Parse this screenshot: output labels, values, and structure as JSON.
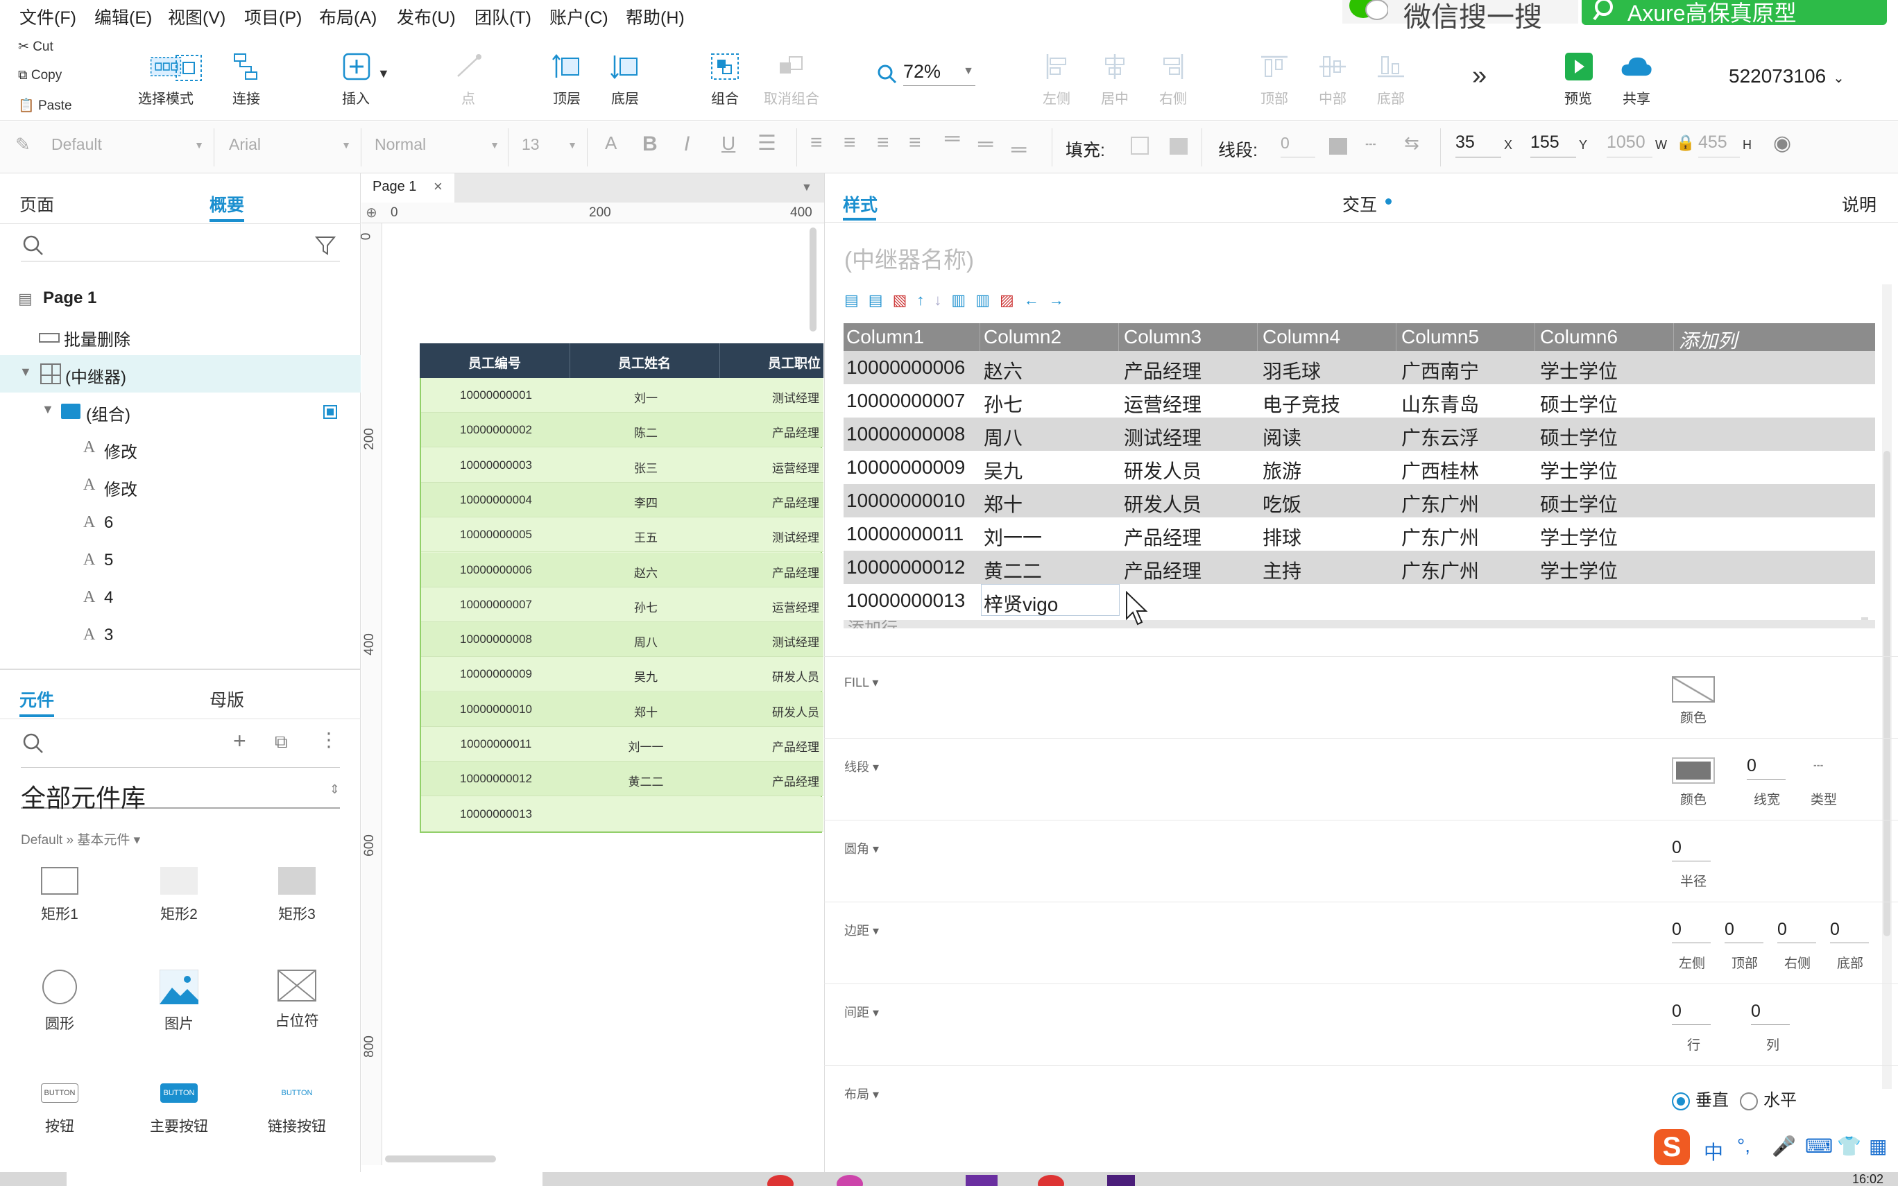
{
  "menu": [
    "文件(F)",
    "编辑(E)",
    "视图(V)",
    "项目(P)",
    "布局(A)",
    "发布(U)",
    "团队(T)",
    "账户(C)",
    "帮助(H)"
  ],
  "clipboard": {
    "cut": "Cut",
    "copy": "Copy",
    "paste": "Paste"
  },
  "tools": {
    "select": "选择模式",
    "connect": "连接",
    "insert": "插入",
    "point": "点",
    "top": "顶层",
    "bottom": "底层",
    "group": "组合",
    "ungroup": "取消组合",
    "zoom": "72%",
    "left": "左侧",
    "center": "居中",
    "right": "右侧",
    "atop": "顶部",
    "amid": "中部",
    "abottom": "底部",
    "preview": "预览",
    "share": "共享",
    "account": "522073106"
  },
  "overlay": {
    "wechat": "微信搜一搜",
    "search": "Axure高保真原型"
  },
  "format": {
    "style": "Default",
    "font": "Arial",
    "weight": "Normal",
    "size": "13",
    "fill": "填充:",
    "stroke": "线段:",
    "stroke_val": "0",
    "x": "35",
    "x_lbl": "X",
    "y": "155",
    "y_lbl": "Y",
    "w": "1050",
    "w_lbl": "W",
    "h": "455",
    "h_lbl": "H"
  },
  "left": {
    "tab_pages": "页面",
    "tab_outline": "概要",
    "outline": [
      "Page 1",
      "批量删除",
      "(中继器)",
      "(组合)",
      "修改",
      "修改",
      "6",
      "5",
      "4",
      "3"
    ],
    "tab_widgets": "元件",
    "tab_masters": "母版",
    "library": "全部元件库",
    "library_sub": "Default » 基本元件 ▾",
    "widgets": [
      "矩形1",
      "矩形2",
      "矩形3",
      "圆形",
      "图片",
      "占位符",
      "按钮",
      "主要按钮",
      "链接按钮"
    ],
    "btn_text": "BUTTON"
  },
  "canvas": {
    "page_tab": "Page 1",
    "ruler_h": [
      "0",
      "200",
      "400"
    ],
    "ruler_v": [
      "0",
      "200",
      "400",
      "600",
      "800"
    ],
    "headers": [
      "员工编号",
      "员工姓名",
      "员工职位"
    ],
    "rows": [
      [
        "10000000001",
        "刘一",
        "测试经理"
      ],
      [
        "10000000002",
        "陈二",
        "产品经理"
      ],
      [
        "10000000003",
        "张三",
        "运营经理"
      ],
      [
        "10000000004",
        "李四",
        "产品经理"
      ],
      [
        "10000000005",
        "王五",
        "测试经理"
      ],
      [
        "10000000006",
        "赵六",
        "产品经理"
      ],
      [
        "10000000007",
        "孙七",
        "运营经理"
      ],
      [
        "10000000008",
        "周八",
        "测试经理"
      ],
      [
        "10000000009",
        "吴九",
        "研发人员"
      ],
      [
        "10000000010",
        "郑十",
        "研发人员"
      ],
      [
        "10000000011",
        "刘一一",
        "产品经理"
      ],
      [
        "10000000012",
        "黄二二",
        "产品经理"
      ],
      [
        "10000000013",
        "",
        ""
      ]
    ]
  },
  "right": {
    "tab_style": "样式",
    "tab_interact": "交互",
    "tab_notes": "说明",
    "name_placeholder": "(中继器名称)",
    "columns": [
      "Column1",
      "Column2",
      "Column3",
      "Column4",
      "Column5",
      "Column6",
      "添加列"
    ],
    "rows": [
      [
        "10000000006",
        "赵六",
        "产品经理",
        "羽毛球",
        "广西南宁",
        "学士学位"
      ],
      [
        "10000000007",
        "孙七",
        "运营经理",
        "电子竞技",
        "山东青岛",
        "硕士学位"
      ],
      [
        "10000000008",
        "周八",
        "测试经理",
        "阅读",
        "广东云浮",
        "硕士学位"
      ],
      [
        "10000000009",
        "吴九",
        "研发人员",
        "旅游",
        "广西桂林",
        "学士学位"
      ],
      [
        "10000000010",
        "郑十",
        "研发人员",
        "吃饭",
        "广东广州",
        "硕士学位"
      ],
      [
        "10000000011",
        "刘一一",
        "产品经理",
        "排球",
        "广东广州",
        "学士学位"
      ],
      [
        "10000000012",
        "黄二二",
        "产品经理",
        "主持",
        "广东广州",
        "学士学位"
      ],
      [
        "10000000013",
        "梓贤vigo",
        "",
        "",
        "",
        ""
      ]
    ],
    "add_row": "添加行",
    "fill": "FILL ▾",
    "fill_color": "颜色",
    "stroke": "线段 ▾",
    "stroke_color": "颜色",
    "stroke_width": "0",
    "stroke_width_lbl": "线宽",
    "stroke_type_lbl": "类型",
    "radius": "圆角 ▾",
    "radius_val": "0",
    "radius_lbl": "半径",
    "padding": "边距 ▾",
    "pad_vals": [
      "0",
      "0",
      "0",
      "0"
    ],
    "pad_lbls": [
      "左侧",
      "顶部",
      "右侧",
      "底部"
    ],
    "spacing": "间距 ▾",
    "sp_vals": [
      "0",
      "0"
    ],
    "sp_lbls": [
      "行",
      "列"
    ],
    "layout": "布局 ▾",
    "layout_v": "垂直",
    "layout_h": "水平"
  },
  "tray": {
    "ime": "中",
    "time": "16:02"
  },
  "colors": {
    "accent": "#1a8fcf",
    "header_dark": "#2e4155",
    "table_green": "#e6f7d5",
    "grid_header": "#8c8c8c",
    "grid_alt": "#d9d9d9"
  }
}
